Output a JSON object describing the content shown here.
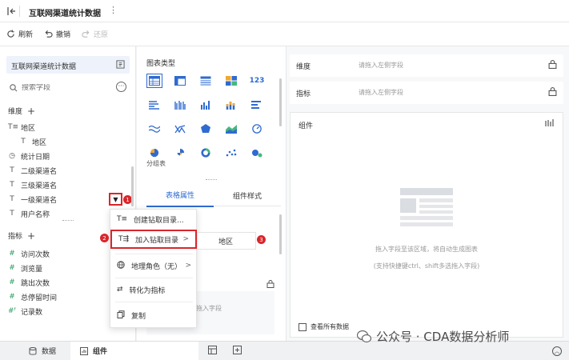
{
  "app": {
    "title": "互联网渠道统计数据"
  },
  "toolbar": {
    "refresh": "刷新",
    "undo": "撤销",
    "redo": "还原"
  },
  "left_panel": {
    "dataset_name": "互联网渠道统计数据",
    "search_placeholder": "搜索字段",
    "dimensions_title": "维度",
    "dimension_fields": [
      {
        "label": "地区",
        "icon": "hierarchy-icon"
      },
      {
        "label": "地区",
        "icon": "text-type-icon",
        "child": true
      },
      {
        "label": "统计日期",
        "icon": "clock-icon"
      },
      {
        "label": "二级渠道名",
        "icon": "text-type-icon"
      },
      {
        "label": "三级渠道名",
        "icon": "text-type-icon"
      },
      {
        "label": "一级渠道名",
        "icon": "text-type-icon"
      },
      {
        "label": "用户名称",
        "icon": "text-type-icon"
      }
    ],
    "measures_title": "指标",
    "measure_fields": [
      {
        "label": "访问次数",
        "icon": "hash-icon"
      },
      {
        "label": "浏览量",
        "icon": "hash-icon"
      },
      {
        "label": "跳出次数",
        "icon": "hash-icon"
      },
      {
        "label": "总停留时间",
        "icon": "hash-icon"
      },
      {
        "label": "记录数",
        "icon": "hash-formula-icon"
      }
    ]
  },
  "middle_panel": {
    "chart_type_title": "图表类型",
    "chart_types": [
      "table-icon",
      "cross-table-icon",
      "list-table-icon",
      "heatmap-table-icon",
      "number-icon",
      "bar-chart-icon",
      "grouped-bar-icon",
      "column-chart-icon",
      "stacked-column-icon",
      "horizontal-bar-icon",
      "line-chart-icon",
      "combo-chart-icon",
      "radar-chart-icon",
      "area-chart-icon",
      "gauge-icon",
      "pie-chart-icon",
      "rose-chart-icon",
      "donut-chart-icon",
      "scatter-chart-icon",
      "bubble-chart-icon"
    ],
    "number_icon_text": "123",
    "chart_type_caption": "分组表",
    "tabs": [
      "表格属性",
      "组件样式"
    ],
    "lower_placeholder": "拖入字段"
  },
  "right_panel": {
    "dimension_label": "维度",
    "dimension_placeholder": "请拖入左侧字段",
    "measure_label": "指标",
    "measure_placeholder": "请拖入左侧字段",
    "component_title": "组件",
    "empty_hint": "拖入字段至该区域，将自动生成图表",
    "empty_hint2": "(支持快捷键ctrl、shift多选拖入字段)",
    "show_all_data": "查看所有数据"
  },
  "context_menu": {
    "items": [
      {
        "label": "创建钻取目录...",
        "icon": "drill-create-icon"
      },
      {
        "label": "加入钻取目录",
        "icon": "drill-add-icon",
        "has_submenu": true
      },
      {
        "label": "地理角色（无）",
        "icon": "globe-icon",
        "has_submenu": true
      },
      {
        "label": "转化为指标",
        "icon": "convert-icon"
      },
      {
        "label": "复制",
        "icon": "copy-icon"
      }
    ],
    "submenu_item": "地区"
  },
  "annotations": {
    "badge1": "1",
    "badge2": "2",
    "badge3": "3"
  },
  "bottom_bar": {
    "tabs": [
      "数据",
      "组件"
    ],
    "active_tab": "组件"
  },
  "watermark": "公众号 · CDA数据分析师",
  "colors": {
    "accent": "#2f6bd1",
    "highlight_red": "#d9262c",
    "selected_bg": "#edf2fb"
  }
}
